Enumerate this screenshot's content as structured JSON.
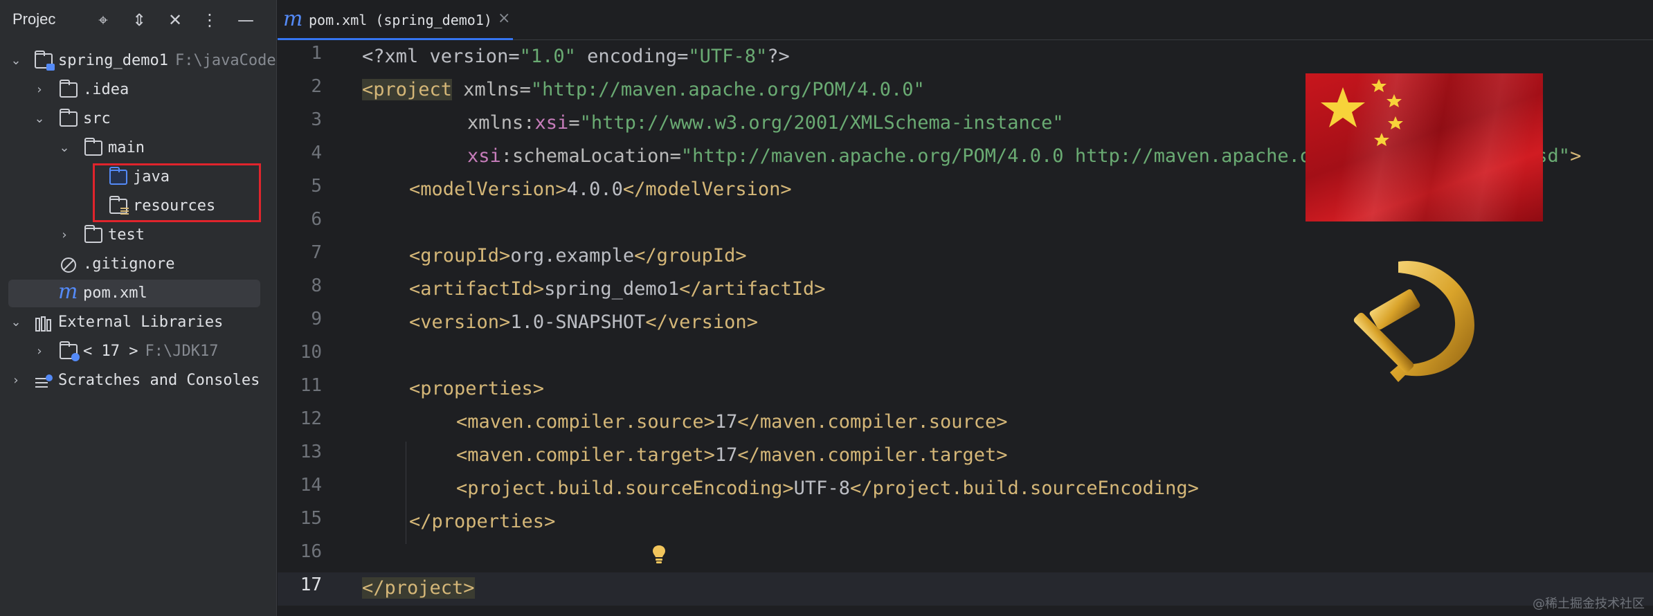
{
  "project_pane": {
    "title": "Projec",
    "tree": [
      {
        "label": "spring_demo1",
        "path": "F:\\javaCode",
        "icon": "module-folder-icon"
      },
      {
        "label": ".idea",
        "icon": "folder-icon"
      },
      {
        "label": "src",
        "icon": "folder-icon"
      },
      {
        "label": "main",
        "icon": "folder-icon"
      },
      {
        "label": "java",
        "icon": "source-folder-icon"
      },
      {
        "label": "resources",
        "icon": "resources-folder-icon"
      },
      {
        "label": "test",
        "icon": "folder-icon"
      },
      {
        "label": ".gitignore",
        "icon": "ignore-file-icon"
      },
      {
        "label": "pom.xml",
        "icon": "maven-file-icon",
        "selected": true
      },
      {
        "label": "External Libraries",
        "icon": "library-icon"
      },
      {
        "label": "< 17 >",
        "path": "F:\\JDK17",
        "icon": "jdk-folder-icon"
      },
      {
        "label": "Scratches and Consoles",
        "icon": "scratches-icon"
      }
    ]
  },
  "editor": {
    "tab": {
      "label": "pom.xml (spring_demo1)"
    },
    "line_numbers": [
      "1",
      "2",
      "3",
      "4",
      "5",
      "6",
      "7",
      "8",
      "9",
      "10",
      "11",
      "12",
      "13",
      "14",
      "15",
      "16",
      "17"
    ],
    "current_line": "17",
    "code": {
      "l1_decl": "<?xml version=",
      "l1_v": "\"1.0\"",
      "l1_enc": " encoding=",
      "l1_ev": "\"UTF-8\"",
      "l1_end": "?>",
      "l2_tag": "<project",
      "l2_attr": " xmlns=",
      "l2_val": "\"http://maven.apache.org/POM/4.0.0\"",
      "l3_attr": "xmlns:",
      "l3_ns": "xsi",
      "l3_eq": "=",
      "l3_val": "\"http://www.w3.org/2001/XMLSchema-instance\"",
      "l4_ns": "xsi",
      "l4_attr": ":schemaLocation=",
      "l4_val": "\"http://maven.apache.org/POM/4.0.0 http://maven.apache.org/xsd/maven-4.0.0.xsd\"",
      "l4_end": ">",
      "l5_open": "<modelVersion>",
      "l5_text": "4.0.0",
      "l5_close": "</modelVersion>",
      "l7_open": "<groupId>",
      "l7_text": "org.example",
      "l7_close": "</groupId>",
      "l8_open": "<artifactId>",
      "l8_text": "spring_demo1",
      "l8_close": "</artifactId>",
      "l9_open": "<version>",
      "l9_text": "1.0-SNAPSHOT",
      "l9_close": "</version>",
      "l11_open": "<properties>",
      "l12_open": "<maven.compiler.source>",
      "l12_text": "17",
      "l12_close": "</maven.compiler.source>",
      "l13_open": "<maven.compiler.target>",
      "l13_text": "17",
      "l13_close": "</maven.compiler.target>",
      "l14_open": "<project.build.sourceEncoding>",
      "l14_text": "UTF-8",
      "l14_close": "</project.build.sourceEncoding>",
      "l15_close": "</properties>",
      "l17_close": "</project>"
    }
  },
  "watermark": "@稀土掘金技术社区",
  "colors": {
    "tag": "#d5b778",
    "string": "#6aab73",
    "namespace": "#c77dbb",
    "highlight_box": "#e0242c",
    "accent": "#3574f0"
  }
}
